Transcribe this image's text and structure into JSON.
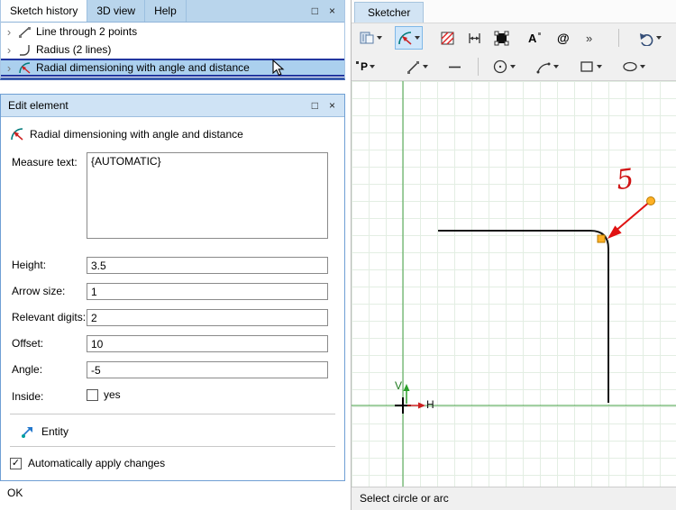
{
  "glyphs": {
    "chevron": "›",
    "maximize": "□",
    "close": "×",
    "check": "✓",
    "at": "@",
    "text_tool": "A",
    "overflow": "»",
    "point_tool": "P"
  },
  "colors": {
    "selection_fill": "#abd0ee",
    "selection_border": "#2236a0",
    "axis_green": "#46a046",
    "dimension_red": "#d01515",
    "handle_orange": "#ffb125",
    "titlebar_blue": "#cfe3f5"
  },
  "history_panel": {
    "tabs": [
      {
        "label": "Sketch history"
      },
      {
        "label": "3D view"
      },
      {
        "label": "Help"
      }
    ],
    "items": [
      {
        "label": "Line through 2 points"
      },
      {
        "label": "Radius (2 lines)"
      },
      {
        "label": "Radial dimensioning with angle and distance"
      }
    ]
  },
  "edit_panel": {
    "title": "Edit element",
    "header": "Radial dimensioning with angle and distance",
    "measure_label": "Measure text:",
    "measure_value": "{AUTOMATIC}",
    "fields": [
      {
        "label": "Height:",
        "value": "3.5"
      },
      {
        "label": "Arrow size:",
        "value": "1"
      },
      {
        "label": "Relevant digits:",
        "value": "2"
      },
      {
        "label": "Offset:",
        "value": "10"
      },
      {
        "label": "Angle:",
        "value": "-5"
      }
    ],
    "inside_label": "Inside:",
    "inside_option": "yes",
    "entity_label": "Entity",
    "auto_apply": "Automatically apply changes",
    "ok": "OK"
  },
  "sketcher": {
    "tab": "Sketcher",
    "status": "Select circle or arc",
    "dimension_value": "5",
    "axis_v": "V",
    "axis_h": "H"
  }
}
